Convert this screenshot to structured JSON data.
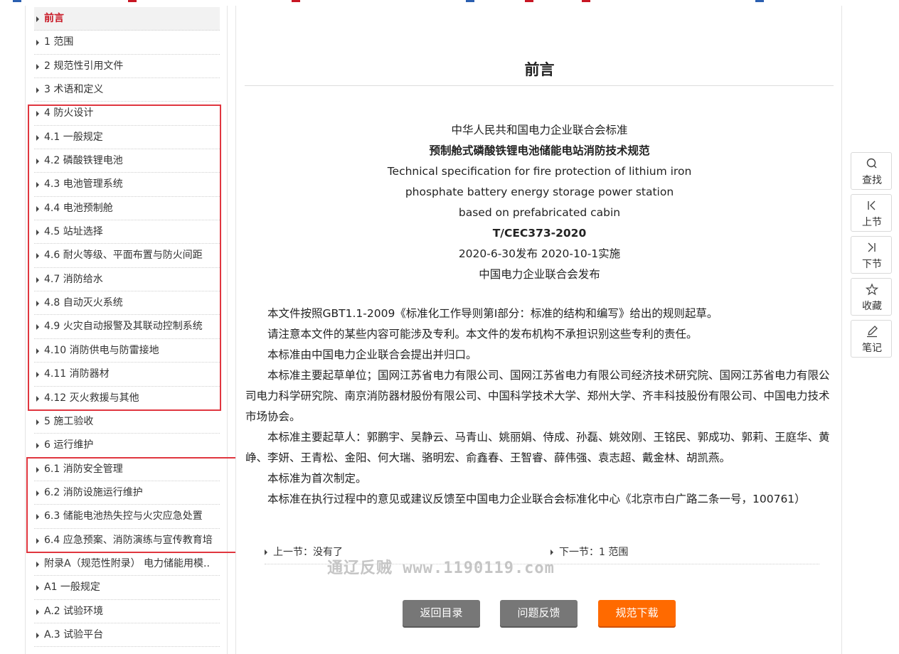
{
  "colors": {
    "accent_red": "#c81623",
    "annotation_box": "#e0363f",
    "download_orange": "#ff6a00",
    "button_gray": "#777777"
  },
  "toc": {
    "items": [
      {
        "label": "前言",
        "active": true
      },
      {
        "label": "1 范围"
      },
      {
        "label": "2 规范性引用文件"
      },
      {
        "label": "3 术语和定义"
      },
      {
        "label": "4 防火设计"
      },
      {
        "label": "4.1 一般规定"
      },
      {
        "label": "4.2 磷酸铁锂电池"
      },
      {
        "label": "4.3 电池管理系统"
      },
      {
        "label": "4.4 电池预制舱"
      },
      {
        "label": "4.5 站址选择"
      },
      {
        "label": "4.6 耐火等级、平面布置与防火间距"
      },
      {
        "label": "4.7 消防给水"
      },
      {
        "label": "4.8 自动灭火系统"
      },
      {
        "label": "4.9 火灾自动报警及其联动控制系统"
      },
      {
        "label": "4.10 消防供电与防雷接地"
      },
      {
        "label": "4.11 消防器材"
      },
      {
        "label": "4.12 灭火救援与其他"
      },
      {
        "label": "5 施工验收"
      },
      {
        "label": "6 运行维护"
      },
      {
        "label": "6.1 消防安全管理"
      },
      {
        "label": "6.2 消防设施运行维护"
      },
      {
        "label": "6.3 储能电池热失控与火灾应急处置"
      },
      {
        "label": "6.4 应急预案、消防演练与宣传教育培"
      },
      {
        "label": "附录A（规范性附录） 电力储能用模.."
      },
      {
        "label": "A1 一般规定"
      },
      {
        "label": "A.2 试验环境"
      },
      {
        "label": "A.3 试验平台"
      }
    ]
  },
  "content": {
    "title": "前言",
    "std_lines": [
      "中华人民共和国电力企业联合会标准",
      "预制舱式磷酸铁锂电池储能电站消防技术规范",
      "Technical specification for fire protection of lithium iron",
      "phosphate battery energy storage power station",
      "based on prefabricated cabin",
      "T/CEC373-2020",
      "2020-6-30发布 2020-10-1实施",
      "中国电力企业联合会发布"
    ],
    "paragraphs": [
      "本文件按照GBT1.1-2009《标准化工作导则第I部分：标准的结构和编写》给出的规则起草。",
      "请注意本文件的某些内容可能涉及专利。本文件的发布机构不承担识别这些专利的责任。",
      "本标准由中国电力企业联合会提出并归口。",
      "本标准主要起草单位；国网江苏省电力有限公司、国网江苏省电力有限公司经济技术研究院、国网江苏省电力有限公司电力科学研究院、南京消防器材股份有限公司、中国科学技术大学、郑州大学、齐丰科技股份有限公司、中国电力技术市场协会。",
      "本标准主要起草人：郭鹏宇、吴静云、马青山、姚丽娟、侍成、孙磊、姚效刚、王铭民、郭成功、郭莉、王庭华、黄峥、李妍、王青松、金阳、何大瑞、骆明宏、俞鑫春、王智睿、薛伟强、袁志超、戴金林、胡凯燕。",
      "本标准为首次制定。",
      "本标准在执行过程中的意见或建议反馈至中国电力企业联合会标准化中心《北京市白广路二条一号，100761）"
    ],
    "prev_link": "上一节：没有了",
    "next_link": "下一节：1 范围",
    "watermark": "通辽反贼 www.1190119.com",
    "buttons": {
      "back": "返回目录",
      "feedback": "问题反馈",
      "download": "规范下载"
    }
  },
  "toolbar": [
    {
      "label": "查找",
      "icon": "search-icon"
    },
    {
      "label": "上节",
      "icon": "prev-section-icon"
    },
    {
      "label": "下节",
      "icon": "next-section-icon"
    },
    {
      "label": "收藏",
      "icon": "star-icon"
    },
    {
      "label": "笔记",
      "icon": "pencil-icon"
    }
  ]
}
